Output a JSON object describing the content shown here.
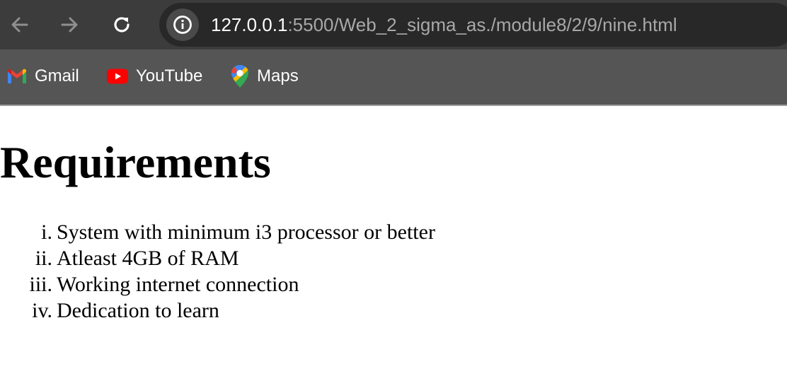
{
  "browser": {
    "url_host": "127.0.0.1",
    "url_rest": ":5500/Web_2_sigma_as./module8/2/9/nine.html",
    "icons": {
      "back": "back-arrow-icon",
      "forward": "forward-arrow-icon",
      "reload": "reload-icon",
      "site_info": "info-icon"
    }
  },
  "bookmarks": [
    {
      "label": "Gmail",
      "icon": "gmail-icon"
    },
    {
      "label": "YouTube",
      "icon": "youtube-icon"
    },
    {
      "label": "Maps",
      "icon": "maps-icon"
    }
  ],
  "page": {
    "title": "Requirements",
    "items": [
      {
        "marker": "i.",
        "text": "System with minimum i3 processor or better"
      },
      {
        "marker": "ii.",
        "text": "Atleast 4GB of RAM"
      },
      {
        "marker": "iii.",
        "text": "Working internet connection"
      },
      {
        "marker": "iv.",
        "text": "Dedication to learn"
      }
    ]
  },
  "colors": {
    "toolbar": "#3c3c3c",
    "omnibox": "#282828",
    "bookmarks_bar": "#555555",
    "youtube_red": "#ff0000"
  }
}
